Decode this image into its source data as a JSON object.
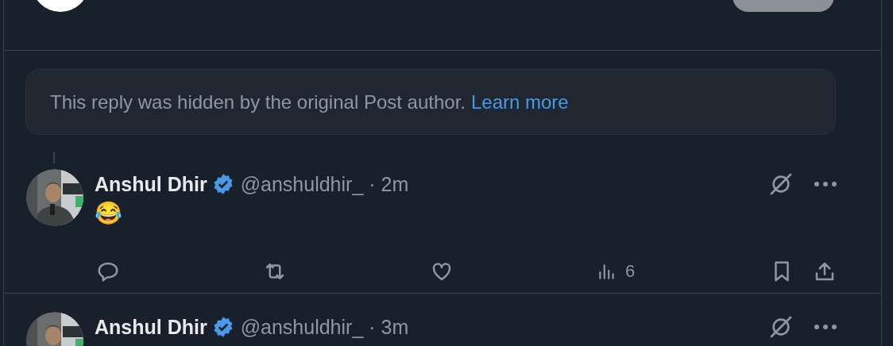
{
  "notice": {
    "text": "This reply was hidden by the original Post author.",
    "link": "Learn more"
  },
  "tweets": [
    {
      "thread_line": true,
      "name": "Anshul Dhir",
      "verified": true,
      "meta": "@anshuldhir_ · 2m",
      "text": "😂",
      "actions": {
        "views": "6"
      }
    },
    {
      "thread_line": false,
      "name": "Anshul Dhir",
      "verified": true,
      "meta": "@anshuldhir_ · 3m"
    }
  ]
}
